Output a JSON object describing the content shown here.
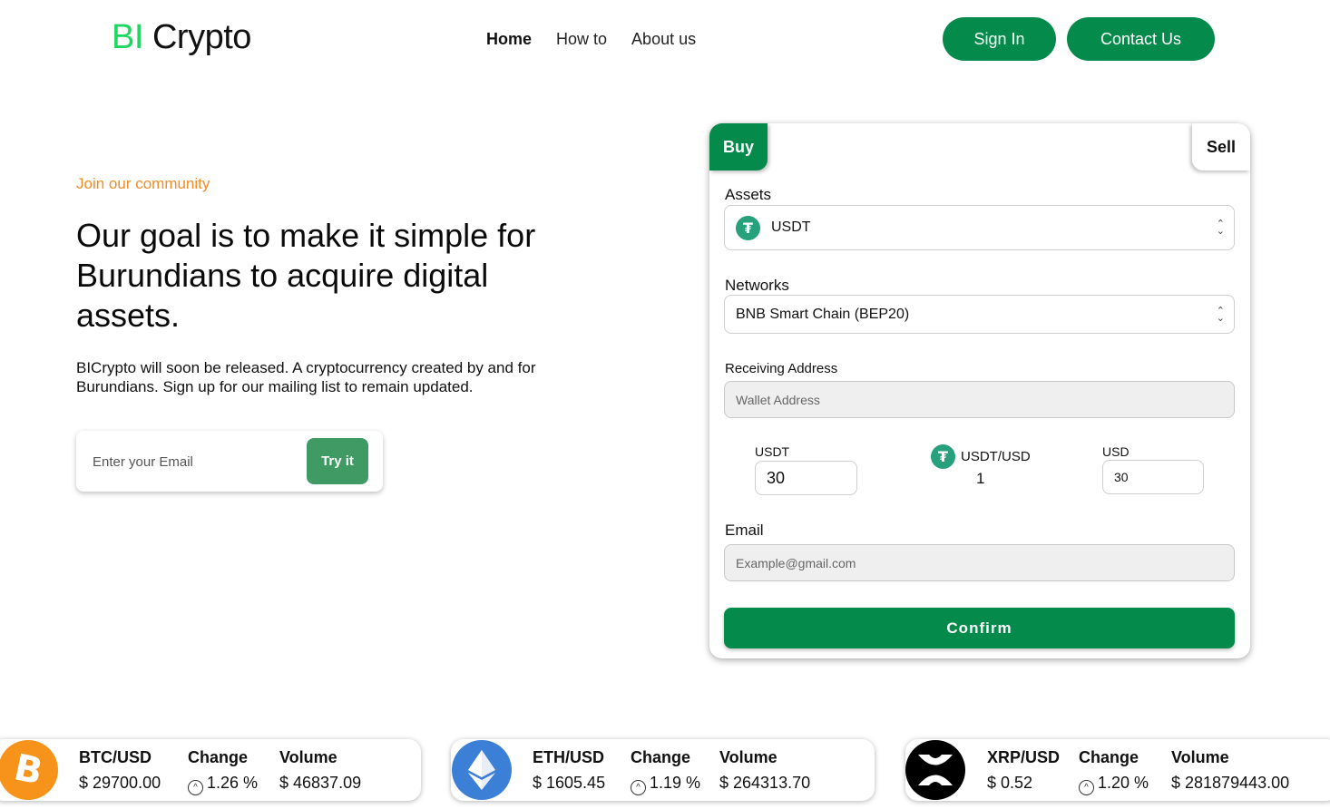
{
  "header": {
    "logo_bi": "BI",
    "logo_crypto": "Crypto",
    "nav": [
      {
        "label": "Home",
        "active": true
      },
      {
        "label": "How to",
        "active": false
      },
      {
        "label": "About us",
        "active": false
      }
    ],
    "signin_label": "Sign In",
    "contact_label": "Contact Us",
    "accent_color": "#048a4a"
  },
  "hero": {
    "eyebrow": "Join our community",
    "headline": "Our goal is to make it simple for Burundians to acquire digital assets.",
    "subtext": "BICrypto will soon be released. A cryptocurrency created by and for Burundians. Sign up for our mailing list to remain updated.",
    "email_placeholder": "Enter your Email",
    "try_label": "Try it"
  },
  "card": {
    "tab_buy": "Buy",
    "tab_sell": "Sell",
    "assets_label": "Assets",
    "assets_value": "USDT",
    "networks_label": "Networks",
    "networks_value": "BNB Smart Chain (BEP20)",
    "address_label": "Receiving Address",
    "address_placeholder": "Wallet Address",
    "usdt_label": "USDT",
    "usdt_value": "30",
    "pair_label": "USDT/USD",
    "pair_rate": "1",
    "usd_label": "USD",
    "usd_value": "30",
    "email_label": "Email",
    "email_placeholder": "Example@gmail.com",
    "confirm_label": "Confirm"
  },
  "ticker": [
    {
      "pair": "BTC/USD",
      "price": "$ 29700.00",
      "change_label": "Change",
      "change": "1.26 %",
      "volume_label": "Volume",
      "volume": "$ 46837.09",
      "icon": "bitcoin-icon",
      "color": "#f7931a"
    },
    {
      "pair": "ETH/USD",
      "price": "$ 1605.45",
      "change_label": "Change",
      "change": "1.19 %",
      "volume_label": "Volume",
      "volume": "$ 264313.70",
      "icon": "ethereum-icon",
      "color": "#3c7fd6"
    },
    {
      "pair": "XRP/USD",
      "price": "$ 0.52",
      "change_label": "Change",
      "change": "1.20 %",
      "volume_label": "Volume",
      "volume": "$ 281879443.00",
      "icon": "xrp-icon",
      "color": "#000000"
    }
  ]
}
